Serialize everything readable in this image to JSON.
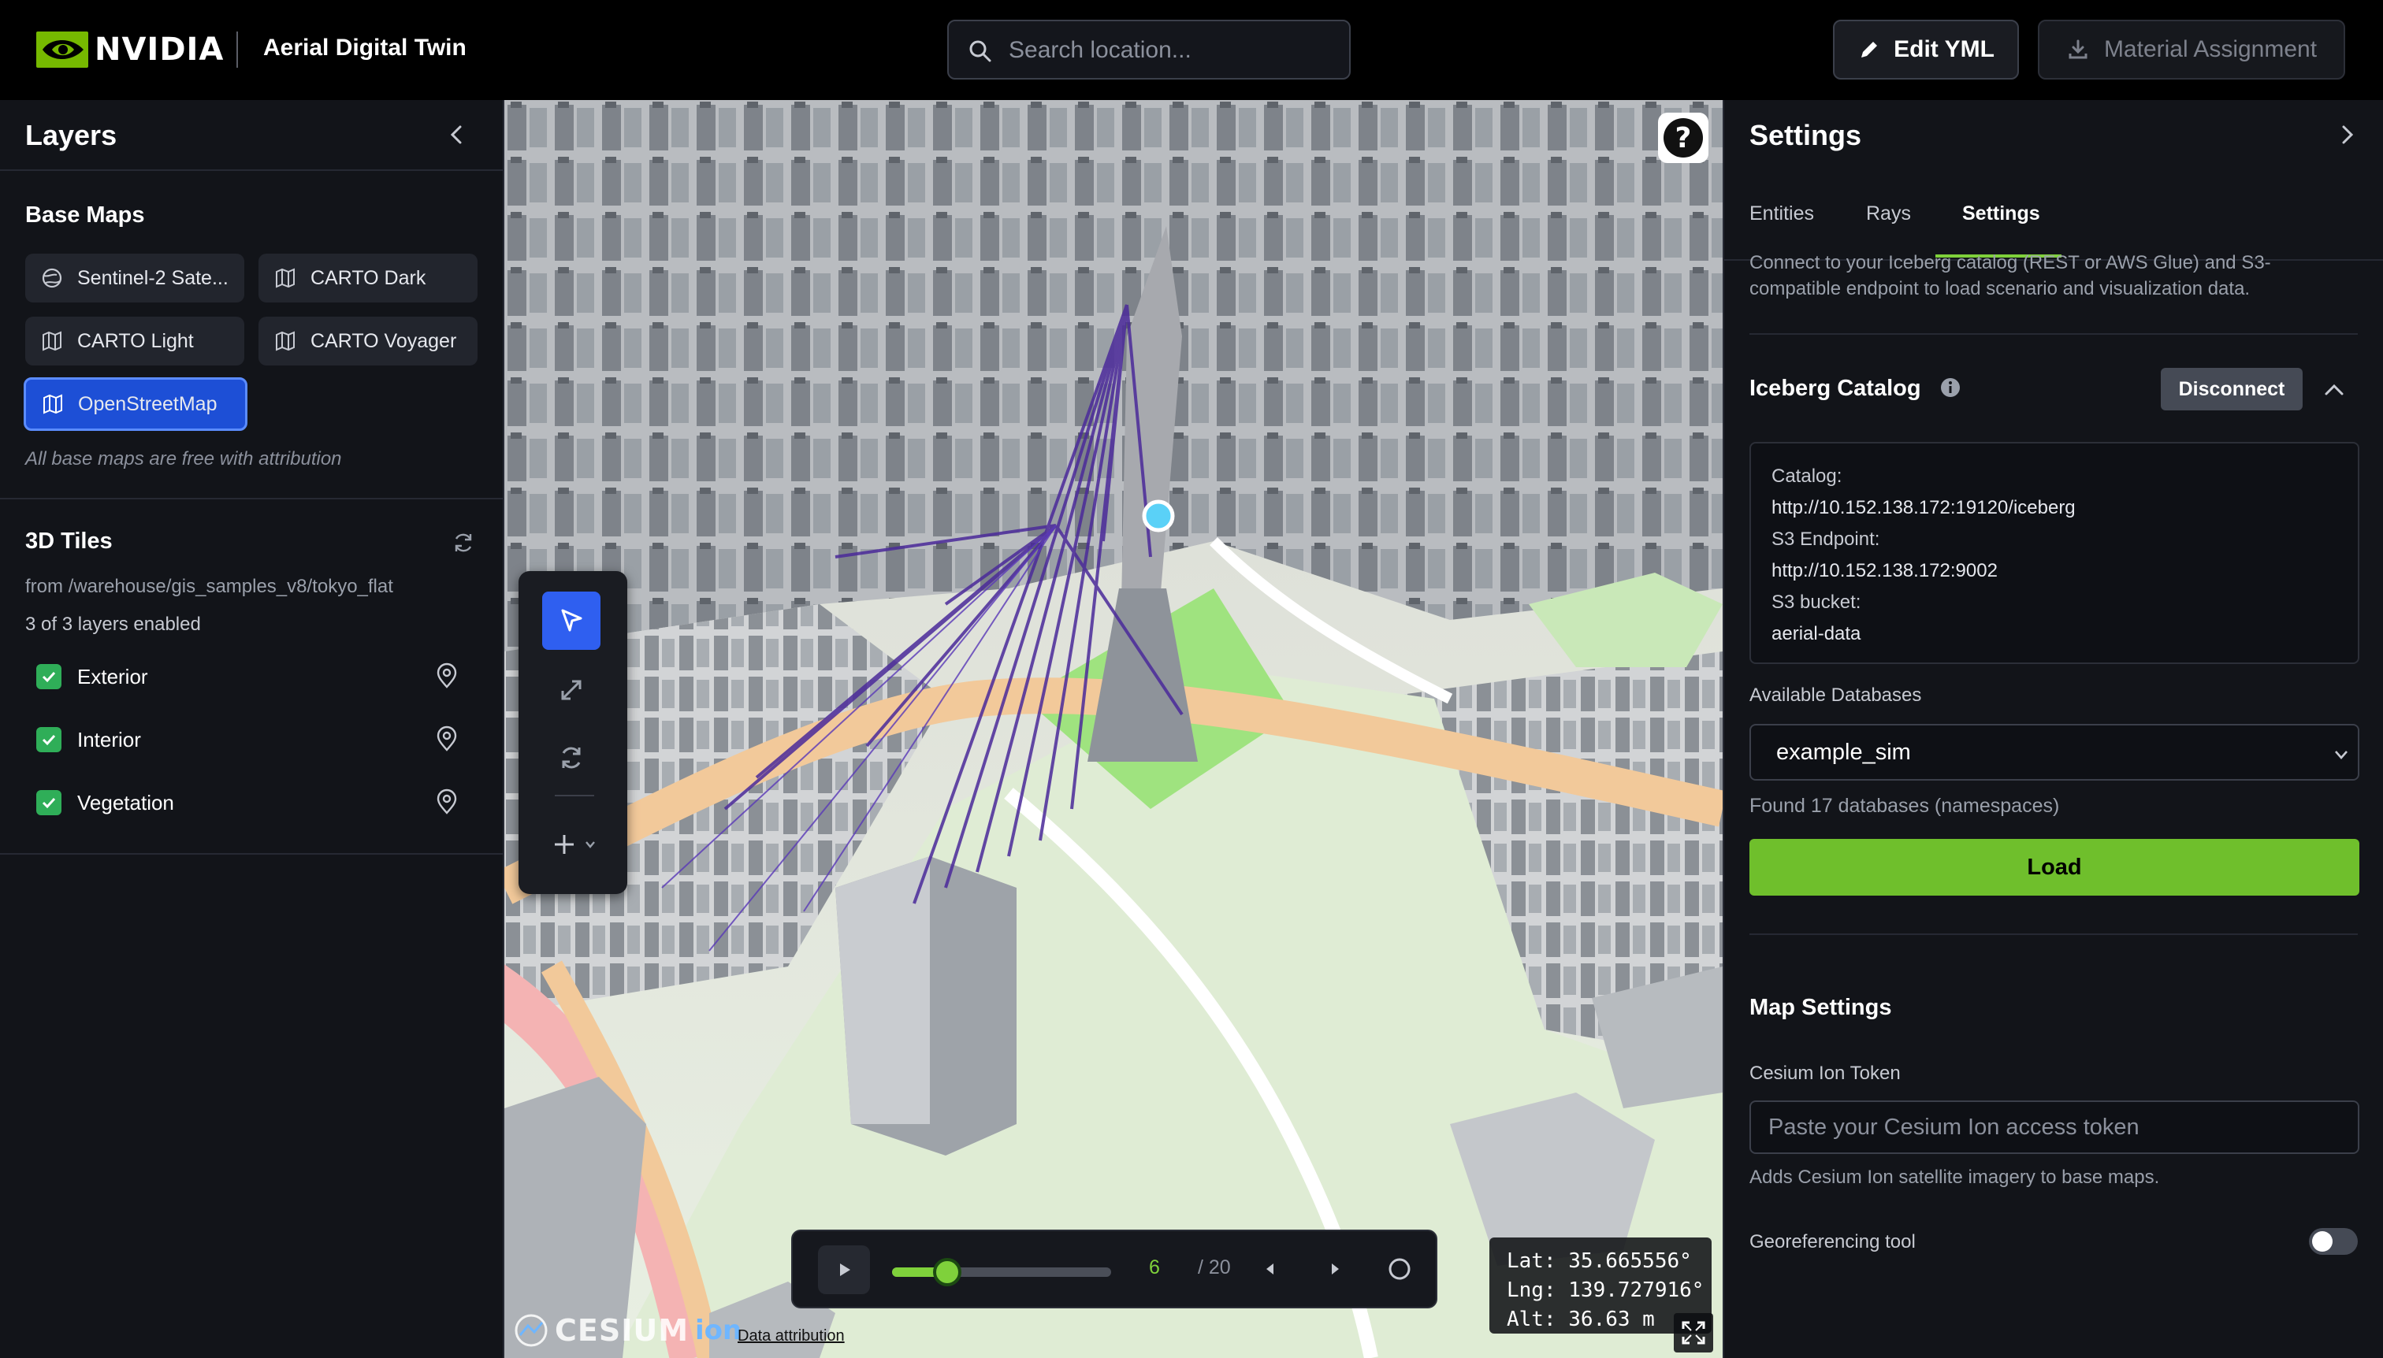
{
  "header": {
    "brand": "NVIDIA",
    "app_title": "Aerial Digital Twin",
    "search_placeholder": "Search location...",
    "edit_button": "Edit YML",
    "material_button": "Material Assignment"
  },
  "layers_panel": {
    "title": "Layers",
    "base_maps": {
      "title": "Base Maps",
      "items": [
        {
          "label": "Sentinel-2 Sate...",
          "icon": "globe-icon",
          "active": false
        },
        {
          "label": "CARTO Dark",
          "icon": "map-icon",
          "active": false
        },
        {
          "label": "CARTO Light",
          "icon": "map-icon",
          "active": false
        },
        {
          "label": "CARTO Voyager",
          "icon": "map-icon",
          "active": false
        },
        {
          "label": "OpenStreetMap",
          "icon": "map-icon",
          "active": true
        }
      ],
      "note": "All base maps are free with attribution"
    },
    "tiles_3d": {
      "title": "3D Tiles",
      "source": "from /warehouse/gis_samples_v8/tokyo_flat",
      "status": "3 of 3 layers enabled",
      "layers": [
        {
          "label": "Exterior",
          "checked": true
        },
        {
          "label": "Interior",
          "checked": true
        },
        {
          "label": "Vegetation",
          "checked": true
        }
      ]
    }
  },
  "map": {
    "help_label": "?",
    "timeline": {
      "current": "6",
      "total": "/ 20",
      "progress": 0.25
    },
    "coords": {
      "lat": "Lat: 35.665556°",
      "lng": "Lng: 139.727916°",
      "alt": "Alt: 36.63 m"
    },
    "cesium_word": "CESIUM",
    "cesium_ion": "ion",
    "attribution": "Data attribution"
  },
  "settings_panel": {
    "title": "Settings",
    "tabs": [
      {
        "label": "Entities",
        "active": false
      },
      {
        "label": "Rays",
        "active": false
      },
      {
        "label": "Settings",
        "active": true
      }
    ],
    "description": "Connect to your Iceberg catalog (REST or AWS Glue) and S3-compatible endpoint to load scenario and visualization data.",
    "iceberg": {
      "title": "Iceberg Catalog",
      "disconnect": "Disconnect",
      "catalog_label": "Catalog:",
      "catalog_value": "http://10.152.138.172:19120/iceberg",
      "s3_endpoint_label": "S3 Endpoint:",
      "s3_endpoint_value": "http://10.152.138.172:9002",
      "s3_bucket_label": "S3 bucket:",
      "s3_bucket_value": "aerial-data"
    },
    "databases": {
      "label": "Available Databases",
      "selected": "example_sim",
      "found": "Found 17 databases (namespaces)",
      "load": "Load"
    },
    "map_settings": {
      "title": "Map Settings",
      "token_label": "Cesium Ion Token",
      "token_placeholder": "Paste your Cesium Ion access token",
      "token_hint": "Adds Cesium Ion satellite imagery to base maps.",
      "georef_label": "Georeferencing tool",
      "georef_enabled": false
    }
  },
  "colors": {
    "accent_green": "#7fd13b",
    "load_green": "#6fbf2c",
    "active_blue": "#1d4fd6",
    "ray_purple": "#4b2a9a"
  }
}
